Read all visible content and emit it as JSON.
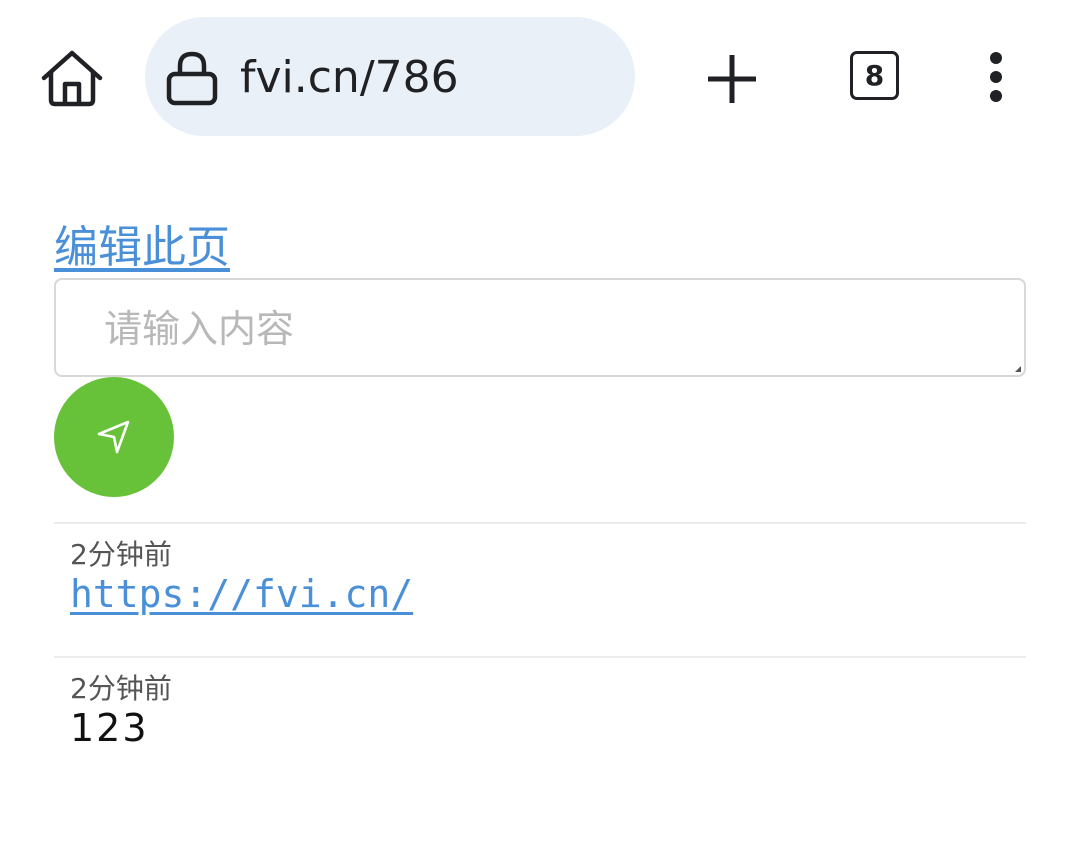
{
  "browser": {
    "url": "fvi.cn/786",
    "tab_count": "8",
    "icons": [
      "home-icon",
      "lock-icon",
      "plus-icon",
      "tab-count-icon",
      "more-vert-icon"
    ]
  },
  "page": {
    "edit_link": "编辑此页",
    "input_placeholder": "请输入内容",
    "send_icon": "send-arrow-icon",
    "accent_color": "#67c23a",
    "link_color": "#4a90d9"
  },
  "entries": [
    {
      "time": "2分钟前",
      "content": "https://fvi.cn/",
      "is_link": true
    },
    {
      "time": "2分钟前",
      "content": "123",
      "is_link": false
    }
  ]
}
